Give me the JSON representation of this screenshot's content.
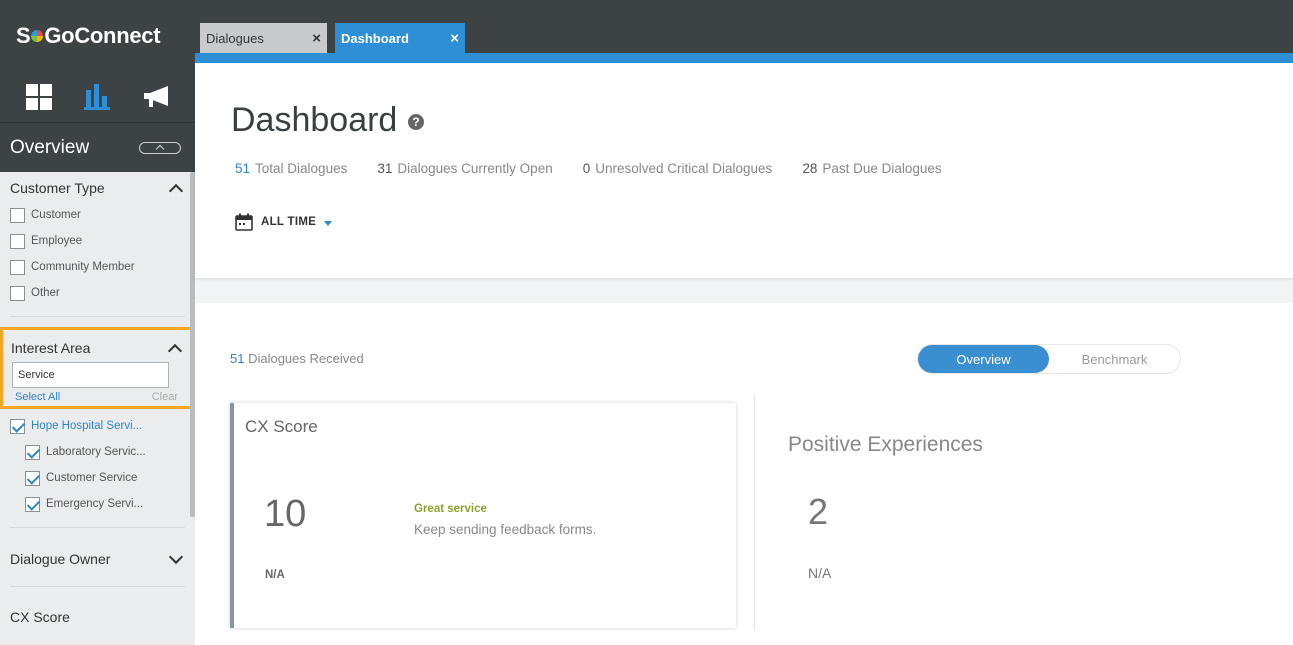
{
  "brand": {
    "logo_pre": "S",
    "logo_post": "GoConnect"
  },
  "sidebar": {
    "overview_title": "Overview",
    "customer_type": {
      "label": "Customer Type",
      "options": [
        {
          "label": "Customer",
          "checked": false
        },
        {
          "label": "Employee",
          "checked": false
        },
        {
          "label": "Community Member",
          "checked": false
        },
        {
          "label": "Other",
          "checked": false
        }
      ]
    },
    "interest_area": {
      "label": "Interest Area",
      "search_value": "Service",
      "select_all": "Select All",
      "clear": "Clear",
      "parent": "Hope Hospital Servi...",
      "children": [
        "Laboratory Servic...",
        "Customer Service",
        "Emergency Servi..."
      ]
    },
    "dialogue_owner": {
      "label": "Dialogue Owner"
    },
    "cx_score": {
      "label": "CX Score"
    }
  },
  "tabs": [
    {
      "label": "Dialogues",
      "close": "×"
    },
    {
      "label": "Dashboard",
      "close": "×"
    }
  ],
  "header": {
    "title": "Dashboard",
    "help": "?",
    "stats": [
      {
        "value": "51",
        "label": "Total Dialogues"
      },
      {
        "value": "31",
        "label": "Dialogues Currently Open"
      },
      {
        "value": "0",
        "label": "Unresolved Critical Dialogues"
      },
      {
        "value": "28",
        "label": "Past Due Dialogues"
      }
    ],
    "date_filter": "ALL TIME"
  },
  "content": {
    "received_count": "51",
    "received_label": " Dialogues Received",
    "toggle": {
      "active": "Overview",
      "inactive": "Benchmark"
    },
    "cx_card": {
      "title": "CX Score",
      "score": "10",
      "na": "N/A",
      "message_title": "Great service",
      "message_body": "Keep sending feedback forms."
    },
    "positive_card": {
      "title": "Positive Experiences",
      "count": "2",
      "na": "N/A"
    }
  },
  "colors": {
    "accent": "#2e8fd6",
    "highlight": "#f5a623",
    "dark": "#3d4345",
    "positive": "#8aa32f"
  }
}
